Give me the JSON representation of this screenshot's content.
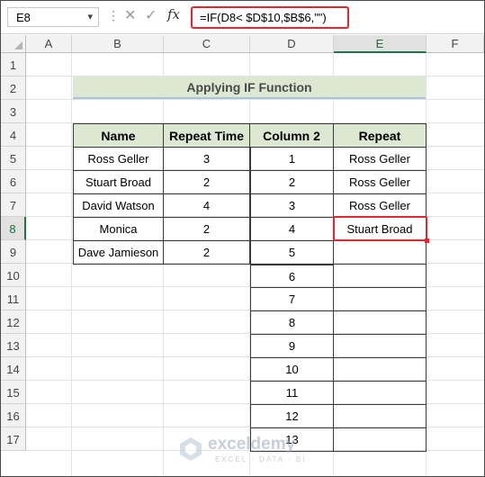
{
  "formula_bar": {
    "name_box": "E8",
    "formula": "=IF(D8< $D$10,$B$6,\"\")",
    "fx_label": "fx"
  },
  "columns": [
    "A",
    "B",
    "C",
    "D",
    "E",
    "F"
  ],
  "rows": [
    "1",
    "2",
    "3",
    "4",
    "5",
    "6",
    "7",
    "8",
    "9",
    "10",
    "11",
    "12",
    "13",
    "14",
    "15",
    "16",
    "17"
  ],
  "active_cell": {
    "column": "E",
    "row": "8"
  },
  "sheet": {
    "title": "Applying IF Function",
    "headers": {
      "name": "Name",
      "repeat_time": "Repeat Time",
      "column2": "Column 2",
      "repeat": "Repeat"
    },
    "table_rows": [
      {
        "name": "Ross Geller",
        "repeat_time": "3",
        "column2": "1",
        "repeat": "Ross Geller"
      },
      {
        "name": "Stuart Broad",
        "repeat_time": "2",
        "column2": "2",
        "repeat": "Ross Geller"
      },
      {
        "name": "David Watson",
        "repeat_time": "4",
        "column2": "3",
        "repeat": "Ross Geller"
      },
      {
        "name": "Monica",
        "repeat_time": "2",
        "column2": "4",
        "repeat": "Stuart Broad"
      },
      {
        "name": "Dave Jamieson",
        "repeat_time": "2",
        "column2": "5",
        "repeat": ""
      },
      {
        "column2": "6",
        "repeat": ""
      },
      {
        "column2": "7",
        "repeat": ""
      },
      {
        "column2": "8",
        "repeat": ""
      },
      {
        "column2": "9",
        "repeat": ""
      },
      {
        "column2": "10",
        "repeat": ""
      },
      {
        "column2": "11",
        "repeat": ""
      },
      {
        "column2": "12",
        "repeat": ""
      },
      {
        "column2": "13",
        "repeat": ""
      }
    ]
  },
  "watermark": {
    "brand": "exceldemy",
    "tagline": "EXCEL · DATA · BI"
  },
  "colors": {
    "accent_red": "#e0282e",
    "header_green": "#dde8d2",
    "excel_green": "#217346"
  }
}
